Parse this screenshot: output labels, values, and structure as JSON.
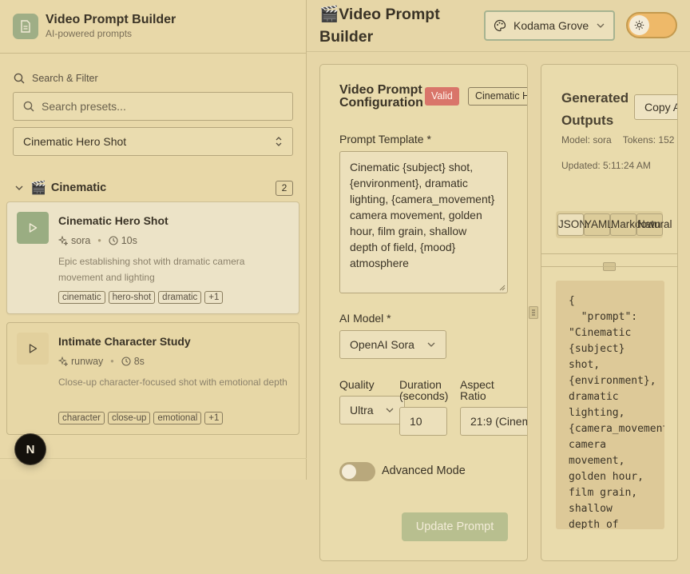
{
  "sidebar": {
    "app_title": "Video Prompt Builder",
    "app_subtitle": "AI-powered prompts",
    "search_filter_label": "Search & Filter",
    "search_placeholder": "Search presets...",
    "selected_preset": "Cinematic Hero Shot",
    "category": {
      "emoji": "🎬",
      "name": "Cinematic",
      "count": "2"
    },
    "cards": [
      {
        "title": "Cinematic Hero Shot",
        "model": "sora",
        "duration": "10s",
        "description": "Epic establishing shot with dramatic camera movement and lighting",
        "tags": [
          "cinematic",
          "hero-shot",
          "dramatic",
          "+1"
        ]
      },
      {
        "title": "Intimate Character Study",
        "model": "runway",
        "duration": "8s",
        "description": "Close-up character-focused shot with emotional depth",
        "tags": [
          "character",
          "close-up",
          "emotional",
          "+1"
        ]
      }
    ],
    "next_badge": "N"
  },
  "header": {
    "title_emoji": "🎬",
    "title": "Video Prompt Builder",
    "theme_name": "Kodama Grove"
  },
  "config": {
    "title": "Video Prompt Configuration",
    "valid_badge": "Valid",
    "preset_badge": "Cinematic H",
    "template_label": "Prompt Template *",
    "template_value": "Cinematic {subject} shot, {environment}, dramatic lighting, {camera_movement} camera movement, golden hour, film grain, shallow depth of field, {mood} atmosphere",
    "model_label": "AI Model *",
    "model_value": "OpenAI Sora",
    "quality_label": "Quality",
    "quality_value": "Ultra",
    "duration_label": "Duration (seconds)",
    "duration_value": "10",
    "aspect_label": "Aspect Ratio",
    "aspect_value": "21:9 (Cinem",
    "advanced_label": "Advanced Mode",
    "update_button": "Update Prompt"
  },
  "outputs": {
    "title": "Generated Outputs",
    "copy_button": "Copy A",
    "model_meta": "Model: sora",
    "tokens_meta": "Tokens: 152",
    "updated": "Updated: 5:11:24 AM",
    "tabs": [
      "JSON",
      "YAML",
      "Markdown",
      "Natural"
    ],
    "code": "{\n  \"prompt\":\n\"Cinematic\n{subject}\nshot,\n{environment},\ndramatic\nlighting,\n{camera_movement}\ncamera\nmovement,\ngolden hour,\nfilm grain,\nshallow\ndepth of"
  },
  "colors": {
    "background": "#e6d6a7",
    "accent_green": "#9aad82",
    "valid_badge": "#d9756a",
    "theme_toggle": "#eeb969"
  },
  "icons": [
    "document-icon",
    "search-icon",
    "chevrons-updown-icon",
    "chevron-down-icon",
    "play-icon",
    "sparkle-icon",
    "clock-icon",
    "palette-icon",
    "sun-icon",
    "grip-icon"
  ]
}
